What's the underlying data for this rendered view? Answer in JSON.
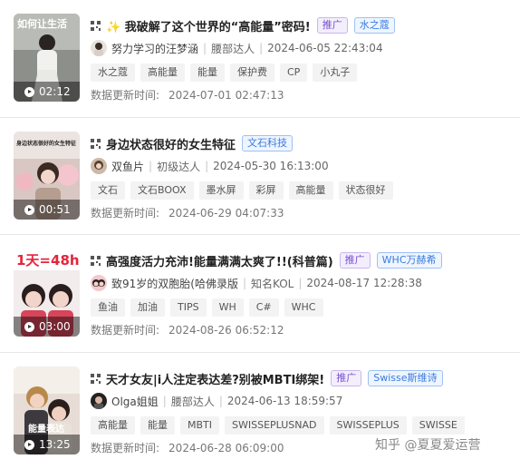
{
  "items": [
    {
      "title": "✨ 我破解了这个世界的“高能量”密码!",
      "tags": [
        "推广",
        "水之蔻"
      ],
      "author": "努力学习的汪梦涵",
      "level": "腰部达人",
      "published": "2024-06-05 22:43:04",
      "chips": [
        "水之蔻",
        "高能量",
        "能量",
        "保护费",
        "CP",
        "小丸子"
      ],
      "updated_label": "数据更新时间:",
      "updated_value": "2024-07-01 02:47:13",
      "duration": "02:12",
      "thumb_text": "如何让生活"
    },
    {
      "title": "身边状态很好的女生特征",
      "tags": [
        "文石科技"
      ],
      "author": "双鱼片",
      "level": "初级达人",
      "published": "2024-05-30 16:13:00",
      "chips": [
        "文石",
        "文石BOOX",
        "墨水屏",
        "彩屏",
        "高能量",
        "状态很好"
      ],
      "updated_label": "数据更新时间:",
      "updated_value": "2024-06-29 04:07:33",
      "duration": "00:51",
      "thumb_text": "身边状态很好的女生特征"
    },
    {
      "title": "高强度活力充沛!能量满满太爽了!!(科普篇)",
      "tags": [
        "推广",
        "WHC万赫希"
      ],
      "author": "致91岁的双胞胎(哈佛录版",
      "level": "知名KOL",
      "published": "2024-08-17 12:28:38",
      "chips": [
        "鱼油",
        "加油",
        "TIPS",
        "WH",
        "C#",
        "WHC"
      ],
      "updated_label": "数据更新时间:",
      "updated_value": "2024-08-26 06:52:12",
      "duration": "03:00",
      "thumb_text": "1天=48h"
    },
    {
      "title": "天才女友|i人注定表达差?别被MBTI绑架!",
      "tags": [
        "推广",
        "Swisse斯维诗"
      ],
      "author": "Olga姐姐",
      "level": "腰部达人",
      "published": "2024-06-13 18:59:57",
      "chips": [
        "高能量",
        "能量",
        "MBTI",
        "SWISSEPLUSNAD",
        "SWISSEPLUS",
        "SWISSE"
      ],
      "updated_label": "数据更新时间:",
      "updated_value": "2024-06-28 06:09:00",
      "duration": "13:25",
      "thumb_text": "能量表达"
    }
  ],
  "watermark": "知乎 @夏夏爱运营",
  "colors": {
    "promo_tag": "#7a4fd0",
    "brand_tag": "#3a7be0",
    "chip_bg": "#f3f3f3"
  },
  "icons": {
    "qr": "qr-code-icon",
    "play": "play-icon"
  }
}
